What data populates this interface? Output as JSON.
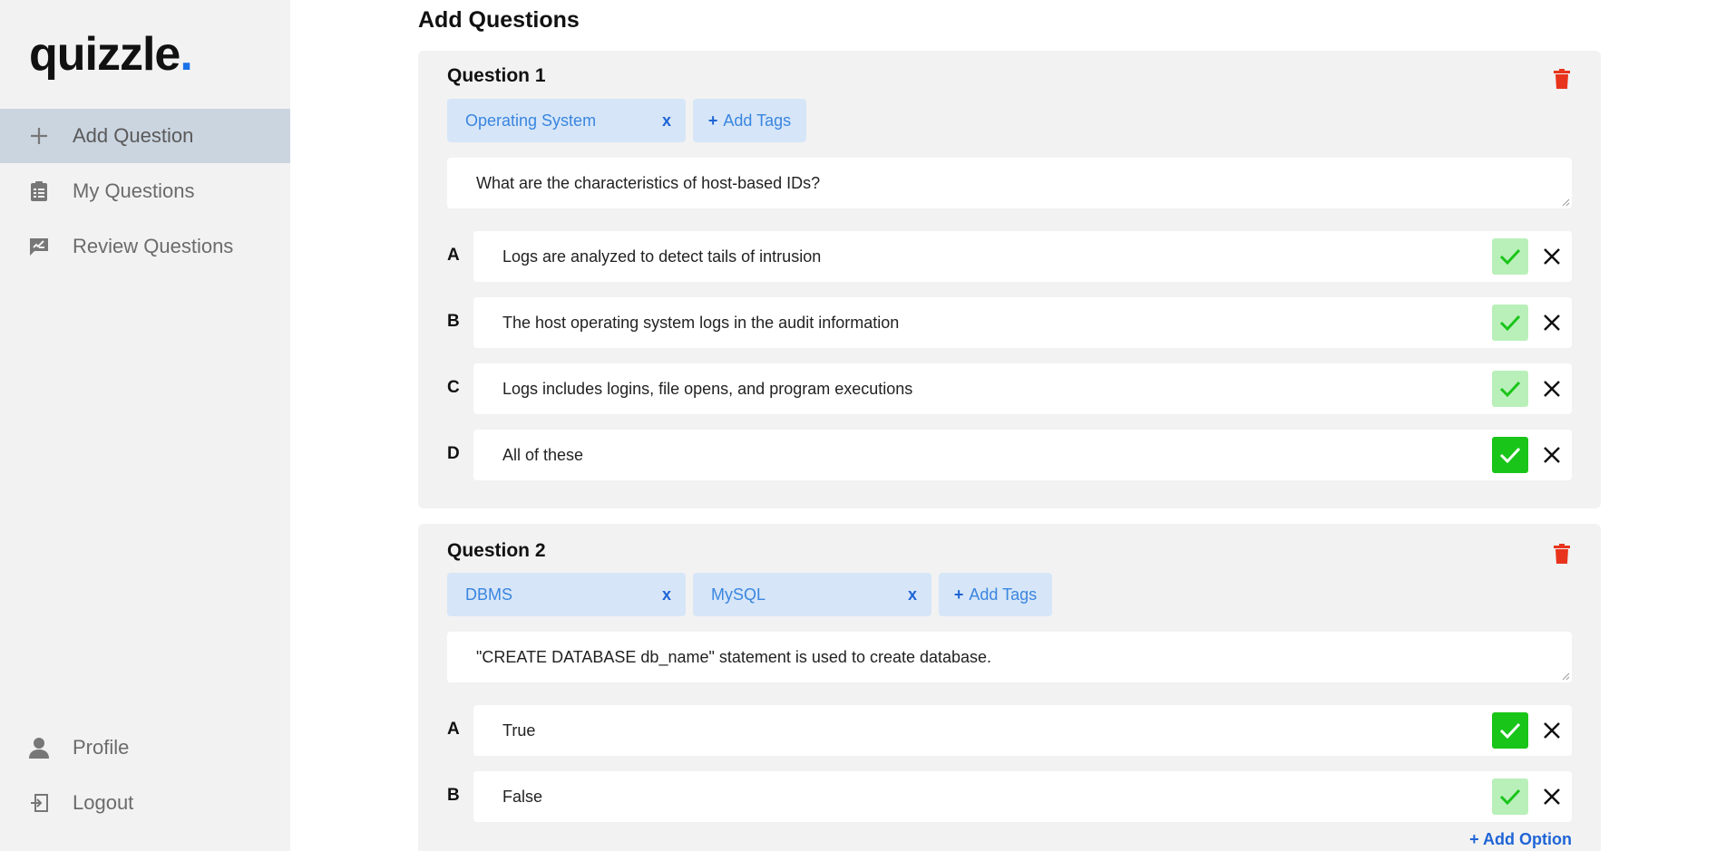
{
  "app": {
    "logo_text": "quizzle",
    "logo_dot": "."
  },
  "sidebar": {
    "items": [
      {
        "label": "Add Question",
        "icon": "plus-icon",
        "active": true
      },
      {
        "label": "My Questions",
        "icon": "clipboard-icon",
        "active": false
      },
      {
        "label": "Review Questions",
        "icon": "review-icon",
        "active": false
      }
    ],
    "bottom": [
      {
        "label": "Profile",
        "icon": "user-icon"
      },
      {
        "label": "Logout",
        "icon": "logout-icon"
      }
    ]
  },
  "page": {
    "title": "Add Questions"
  },
  "questions": [
    {
      "title": "Question 1",
      "tags": [
        {
          "label": "Operating System",
          "remove": "x"
        }
      ],
      "add_tags_label": "Add Tags",
      "add_tags_plus": "+",
      "text": "What are the characteristics of host-based IDs?",
      "options": [
        {
          "letter": "A",
          "text": "Logs are analyzed to detect tails of intrusion",
          "correct": false
        },
        {
          "letter": "B",
          "text": "The host operating system logs in the audit information",
          "correct": false
        },
        {
          "letter": "C",
          "text": "Logs includes logins, file opens, and program executions",
          "correct": false
        },
        {
          "letter": "D",
          "text": "All of these",
          "correct": true
        }
      ]
    },
    {
      "title": "Question 2",
      "tags": [
        {
          "label": "DBMS",
          "remove": "x"
        },
        {
          "label": "MySQL",
          "remove": "x"
        }
      ],
      "add_tags_label": "Add Tags",
      "add_tags_plus": "+",
      "text": "\"CREATE DATABASE db_name\" statement is used to create database.",
      "options": [
        {
          "letter": "A",
          "text": "True",
          "correct": true
        },
        {
          "letter": "B",
          "text": "False",
          "correct": false
        }
      ],
      "add_option_label": "+  Add Option"
    }
  ],
  "colors": {
    "accent": "#1a73e8",
    "correct_on": "#19c519",
    "correct_off": "#b9f0b9",
    "delete": "#e8341c",
    "tag_bg": "#d6e6f8"
  }
}
